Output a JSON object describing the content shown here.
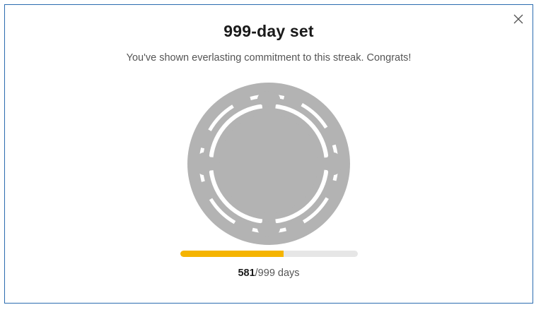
{
  "dialog": {
    "title": "999-day set",
    "subtitle": "You've shown everlasting commitment to this streak. Congrats!",
    "close_icon": "close-icon",
    "badge_icon": "locked-streak-badge-icon",
    "badge_color": "#b3b3b3",
    "progress": {
      "current": "581",
      "separator_total": "/999 days",
      "current_value": 581,
      "total_value": 999,
      "bar_color": "#f5b400",
      "track_color": "#e6e6e6"
    }
  }
}
